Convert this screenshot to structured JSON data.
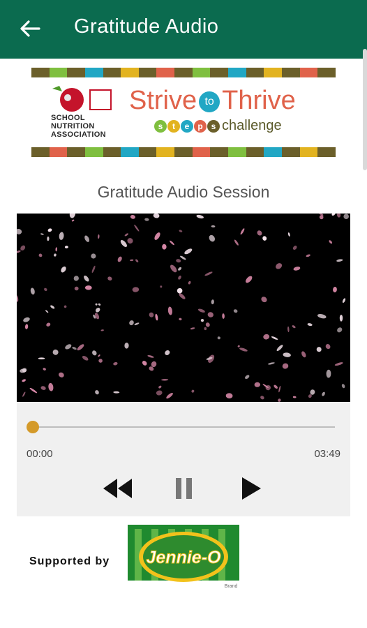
{
  "appbar": {
    "title": "Gratitude Audio",
    "back_icon": "arrow-left-icon"
  },
  "banner": {
    "org_line1": "SCHOOL",
    "org_line2": "NUTRITION",
    "org_line3": "ASSOCIATION",
    "strive": "Strive",
    "to": "to",
    "thrive": "Thrive",
    "steps_letters": [
      "s",
      "t",
      "e",
      "p",
      "s"
    ],
    "challenge": "challenge",
    "colors": {
      "olive": "#6b5f2a",
      "green": "#7fbf3f",
      "teal": "#21a7c4",
      "yellow": "#e2b320",
      "orange": "#e0624a"
    }
  },
  "session": {
    "title": "Gratitude Audio Session"
  },
  "player": {
    "current_time": "00:00",
    "total_time": "03:49",
    "progress": 0.0,
    "rewind_icon": "rewind-icon",
    "pause_icon": "pause-icon",
    "play_icon": "play-icon",
    "accent": "#d49a2a"
  },
  "sponsor": {
    "label": "Supported by",
    "brand": "Jennie-O",
    "brand_sub": "Brand"
  }
}
